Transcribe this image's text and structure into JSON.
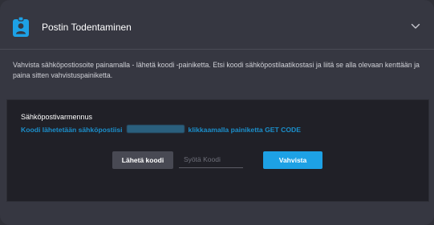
{
  "header": {
    "title": "Postin Todentaminen",
    "icon": "id-badge-icon",
    "expand_icon": "chevron-down-icon"
  },
  "description": "Vahvista sähköpostiosoite painamalla - lähetä koodi -painiketta. Etsi koodi sähköpostilaatikostasi ja liitä se alla olevaan kenttään ja paina sitten vahvistuspainiketta.",
  "verification": {
    "title": "Sähköpostivarmennus",
    "info_prefix": "Koodi lähetetään sähköpostiisi",
    "info_suffix": "klikkaamalla painiketta GET CODE",
    "send_label": "Lähetä koodi",
    "code_placeholder": "Syötä Koodi",
    "confirm_label": "Vahvista"
  },
  "colors": {
    "accent": "#1da1e5",
    "link": "#1b8fcb",
    "background": "#363741",
    "panel": "#202027"
  }
}
